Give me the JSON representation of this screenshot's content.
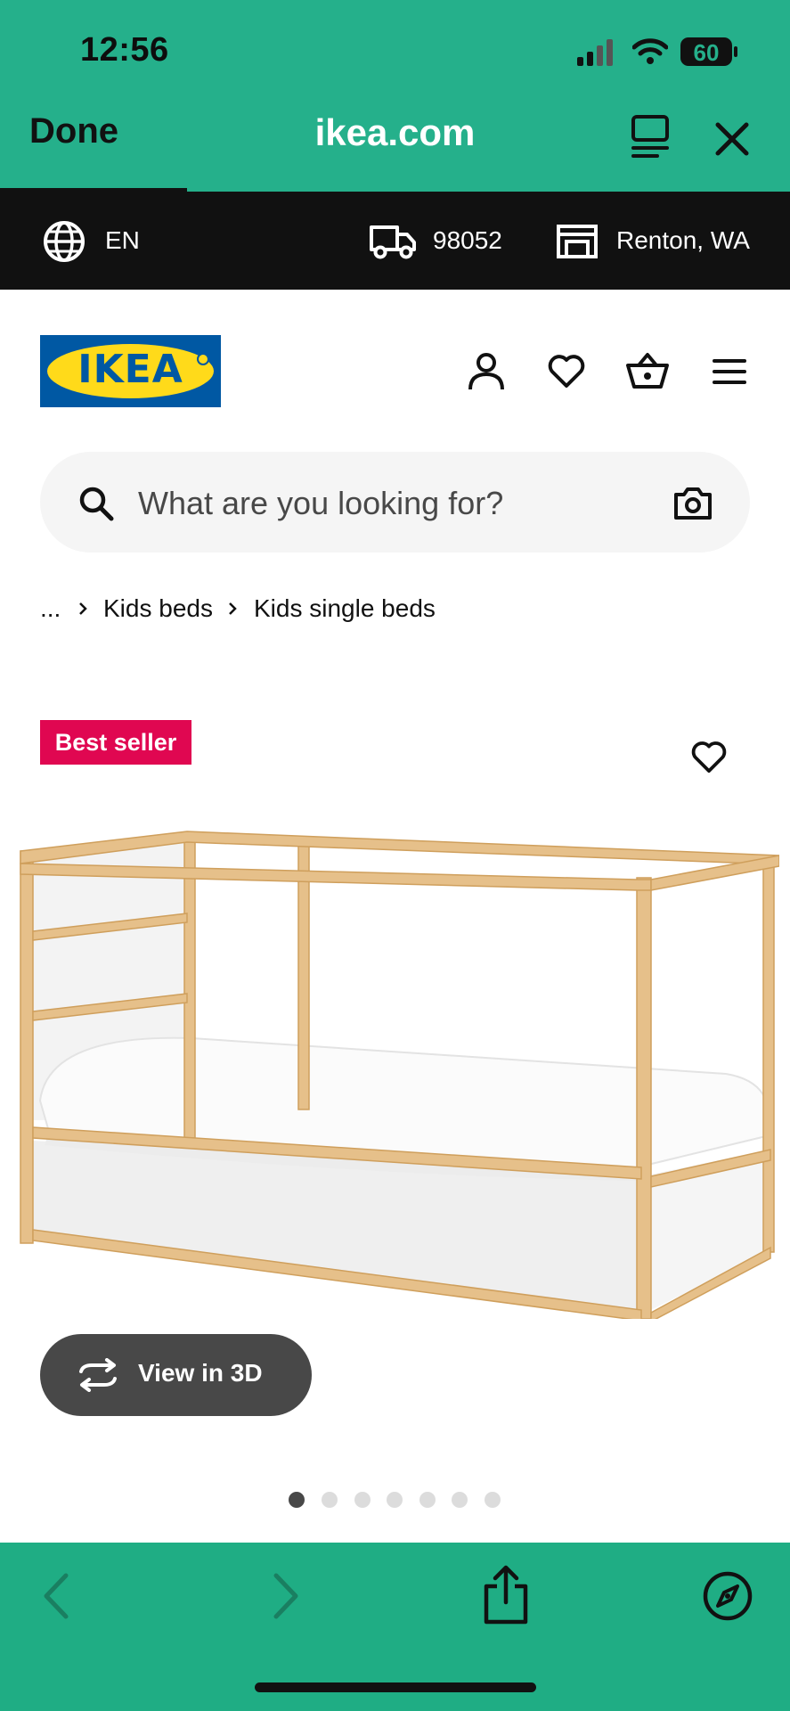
{
  "status": {
    "time": "12:56",
    "battery": "60"
  },
  "browser": {
    "done_label": "Done",
    "url": "ikea.com"
  },
  "info_bar": {
    "language": "EN",
    "zip": "98052",
    "store": "Renton, WA"
  },
  "header": {
    "logo_text": "IKEA"
  },
  "search": {
    "placeholder": "What are you looking for?"
  },
  "breadcrumb": {
    "items": [
      "...",
      "Kids beds",
      "Kids single beds"
    ]
  },
  "product": {
    "badge": "Best seller",
    "view3d_label": "View in 3D",
    "image_count": 7,
    "active_image": 1
  },
  "colors": {
    "browser_chrome": "#25b08b",
    "badge": "#e00751",
    "info_bar": "#111111",
    "ikea_blue": "#0058a3",
    "ikea_yellow": "#ffda1a"
  }
}
